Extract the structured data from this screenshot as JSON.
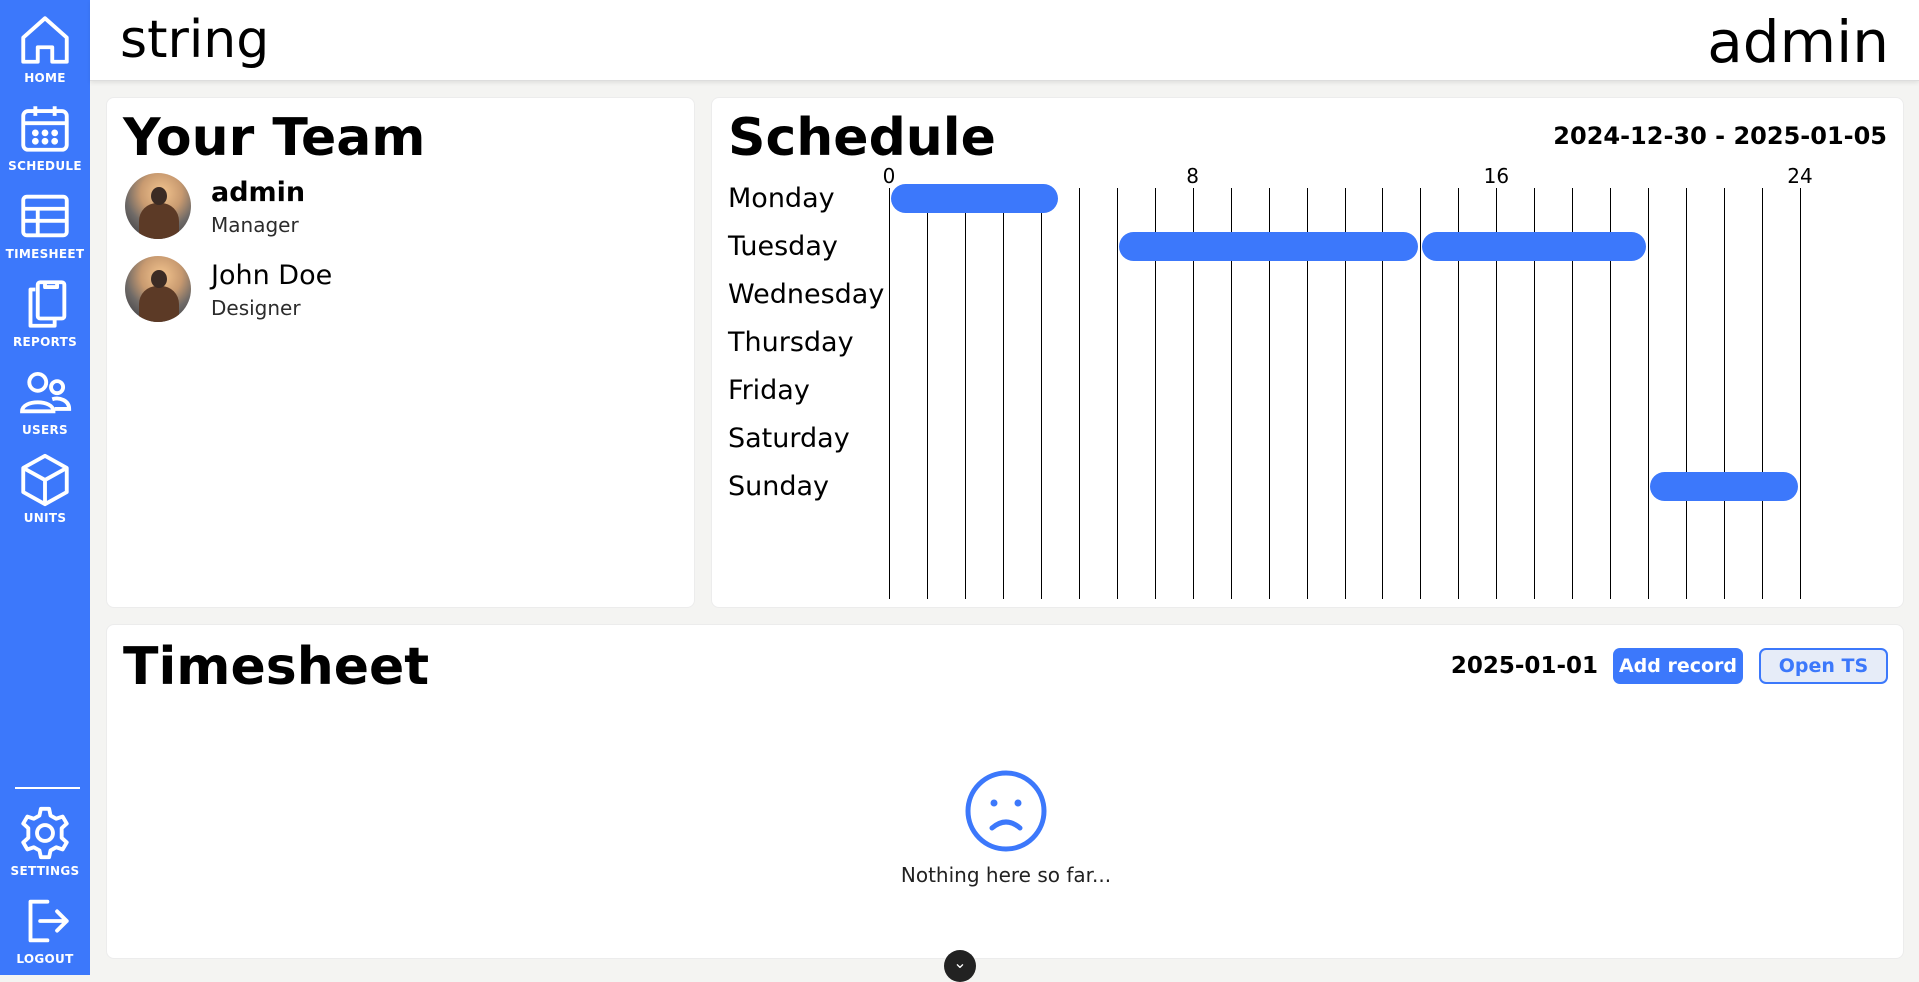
{
  "sidebar": {
    "items": [
      {
        "label": "HOME"
      },
      {
        "label": "SCHEDULE"
      },
      {
        "label": "TIMESHEET"
      },
      {
        "label": "REPORTS"
      },
      {
        "label": "USERS"
      },
      {
        "label": "UNITS"
      }
    ],
    "bottom_items": [
      {
        "label": "SETTINGS"
      },
      {
        "label": "LOGOUT"
      }
    ]
  },
  "header": {
    "title": "string",
    "user": "admin"
  },
  "team": {
    "title": "Your Team",
    "members": [
      {
        "name": "admin",
        "role": "Manager"
      },
      {
        "name": "John Doe",
        "role": "Designer"
      }
    ]
  },
  "schedule": {
    "title": "Schedule",
    "range": "2024-12-30 - 2025-01-05",
    "hour_ticks": [
      "0",
      "8",
      "16",
      "24"
    ],
    "days": [
      "Monday",
      "Tuesday",
      "Wednesday",
      "Thursday",
      "Friday",
      "Saturday",
      "Sunday"
    ],
    "shifts": [
      {
        "day": 0,
        "start": 0,
        "end": 4.5
      },
      {
        "day": 1,
        "start": 6,
        "end": 14
      },
      {
        "day": 1,
        "start": 14,
        "end": 20
      },
      {
        "day": 6,
        "start": 20,
        "end": 24
      }
    ],
    "bar_color": "#3c78fb"
  },
  "timesheet": {
    "title": "Timesheet",
    "date": "2025-01-01",
    "add_label": "Add record",
    "open_label": "Open TS",
    "empty_text": "Nothing here so far...",
    "empty_icon": "sad-face-icon"
  },
  "colors": {
    "accent": "#3c78fb"
  }
}
